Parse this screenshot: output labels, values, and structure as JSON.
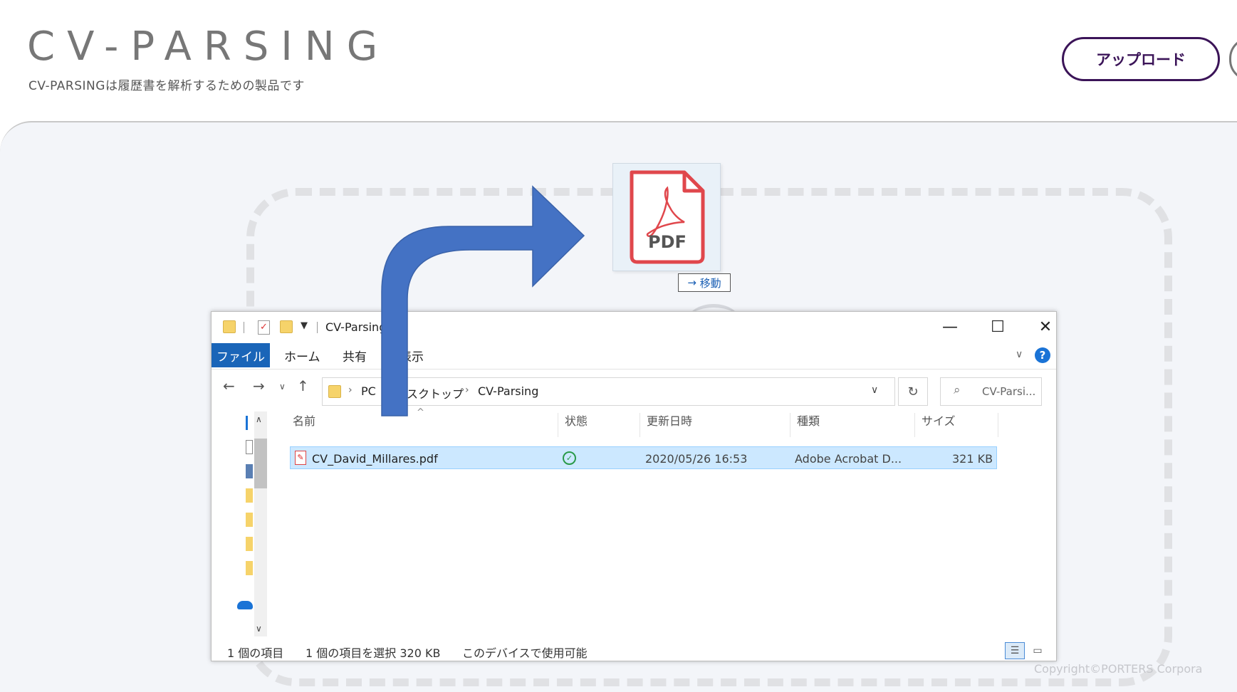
{
  "header": {
    "title": "CV-PARSING",
    "subtitle": "CV-PARSINGは履歴書を解析するための製品です",
    "upload_label": "アップロード"
  },
  "drag": {
    "pdf_label": "PDF",
    "move_label": "移動",
    "accent_color": "#e0474c",
    "arrow_color": "#4472c4"
  },
  "footer": {
    "copyright": "Copyright©PORTERS Corpora"
  },
  "explorer": {
    "title": "CV-Parsing",
    "ribbon_tabs": [
      "ファイル",
      "ホーム",
      "共有",
      "表示"
    ],
    "window_controls": {
      "minimize": "—",
      "maximize": "☐",
      "close": "✕"
    },
    "address": [
      "PC",
      "デスクトップ",
      "CV-Parsing"
    ],
    "search_placeholder": "CV-Parsi...",
    "columns": [
      "名前",
      "状態",
      "更新日時",
      "種類",
      "サイズ"
    ],
    "files": [
      {
        "name": "CV_David_Millares.pdf",
        "date": "2020/05/26 16:53",
        "type": "Adobe Acrobat D...",
        "size": "321 KB"
      }
    ],
    "status": {
      "count": "1 個の項目",
      "selected": "1 個の項目を選択  320 KB",
      "availability": "このデバイスで使用可能"
    }
  }
}
